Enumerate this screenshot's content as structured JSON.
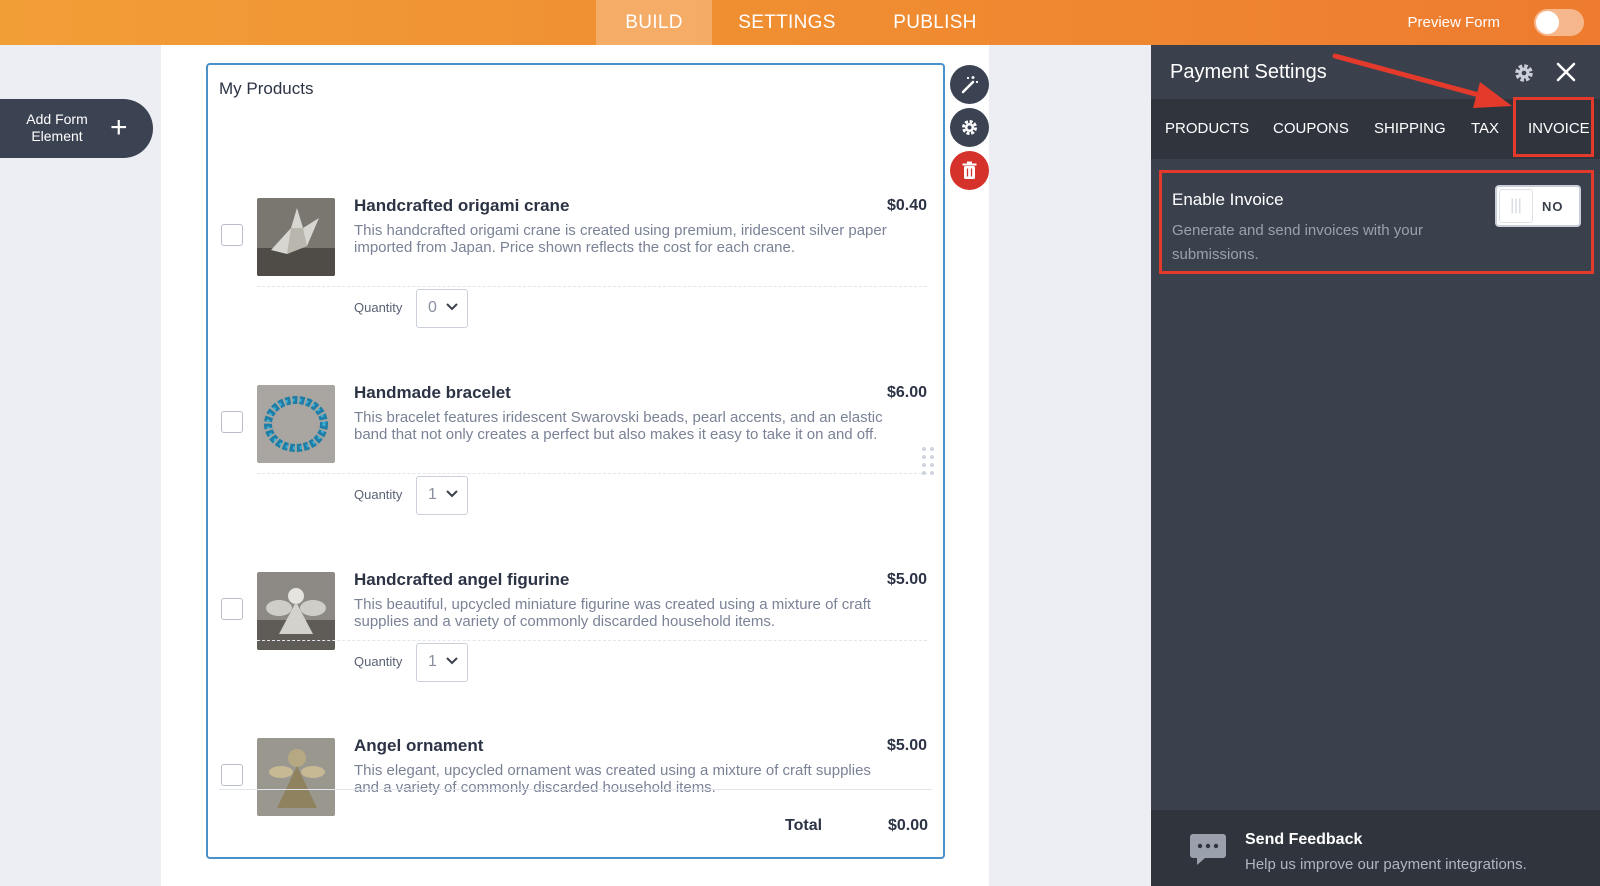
{
  "topbar": {
    "tabs": [
      "BUILD",
      "SETTINGS",
      "PUBLISH"
    ],
    "preview_label": "Preview Form"
  },
  "add_element": {
    "label": "Add Form Element"
  },
  "form": {
    "title": "My Products",
    "items": [
      {
        "name": "Handcrafted origami crane",
        "price": "$0.40",
        "description": "This handcrafted origami crane is created using premium, iridescent silver paper imported from Japan. Price shown reflects the cost for each crane.",
        "quantity_label": "Quantity",
        "quantity": "0"
      },
      {
        "name": "Handmade bracelet",
        "price": "$6.00",
        "description": "This bracelet features iridescent Swarovski beads, pearl accents, and an elastic band that not only creates a perfect but also makes it easy to take it on and off.",
        "quantity_label": "Quantity",
        "quantity": "1"
      },
      {
        "name": "Handcrafted angel figurine",
        "price": "$5.00",
        "description": "This beautiful, upcycled miniature figurine was created using a mixture of craft supplies and a variety of commonly discarded household items.",
        "quantity_label": "Quantity",
        "quantity": "1"
      },
      {
        "name": "Angel ornament",
        "price": "$5.00",
        "description": "This elegant, upcycled ornament was created using a mixture of craft supplies and a variety of commonly discarded household items."
      }
    ],
    "total_label": "Total",
    "total_value": "$0.00"
  },
  "panel": {
    "title": "Payment Settings",
    "tabs": [
      "PRODUCTS",
      "COUPONS",
      "SHIPPING",
      "TAX",
      "INVOICE"
    ],
    "invoice": {
      "title": "Enable Invoice",
      "description": "Generate and send invoices with your submissions.",
      "toggle_label": "NO"
    },
    "feedback": {
      "title": "Send Feedback",
      "subtitle": "Help us improve our payment integrations."
    }
  },
  "colors": {
    "topbar": "#ef8a31",
    "panel": "#3b414c",
    "highlight": "#e43a2b",
    "card_border": "#4a90c9",
    "delete": "#d5322b"
  }
}
